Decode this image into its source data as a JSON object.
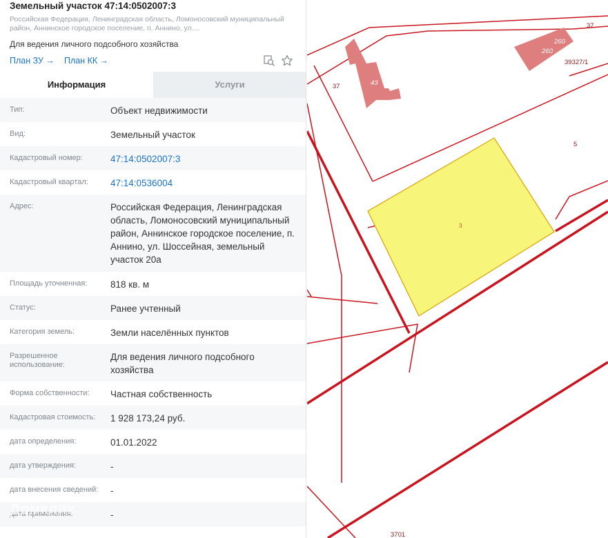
{
  "header": {
    "title": "Земельный участок 47:14:0502007:3",
    "address_short": "Российская Федерация, Ленинградская область, Ломоносовский муниципальный район, Аннинское городское поселение, п. Аннино, ул....",
    "purpose": "Для ведения личного подсобного хозяйства",
    "plan_zu": "План ЗУ →",
    "plan_kk": "План КК →"
  },
  "tabs": [
    {
      "label": "Информация"
    },
    {
      "label": "Услуги"
    }
  ],
  "info": [
    {
      "label": "Тип:",
      "value": "Объект недвижимости"
    },
    {
      "label": "Вид:",
      "value": "Земельный участок"
    },
    {
      "label": "Кадастровый номер:",
      "value": "47:14:0502007:3"
    },
    {
      "label": "Кадастровый квартал:",
      "value": "47:14:0536004"
    },
    {
      "label": "Адрес:",
      "value": "Российская Федерация, Ленинградская область, Ломоносовский муниципальный район, Аннинское городское поселение, п. Аннино, ул. Шоссейная, земельный участок 20а"
    },
    {
      "label": "Площадь уточненная:",
      "value": "818 кв. м"
    },
    {
      "label": "Статус:",
      "value": "Ранее учтенный"
    },
    {
      "label": "Категория земель:",
      "value": "Земли населённых пунктов"
    },
    {
      "label": "Разрешенное использование:",
      "value": "Для ведения личного подсобного хозяйства"
    },
    {
      "label": "Форма собственности:",
      "value": "Частная собственность"
    },
    {
      "label": "Кадастровая стоимость:",
      "value": "1 928 173,24 руб."
    },
    {
      "label": "дата определения:",
      "value": "01.01.2022"
    },
    {
      "label": "дата утверждения:",
      "value": "-"
    },
    {
      "label": "дата внесения сведений:",
      "value": "-"
    },
    {
      "label": "дата применения:",
      "value": "-"
    }
  ],
  "map": {
    "labels": {
      "a": "37",
      "b": "37",
      "c": "43",
      "d": "260",
      "e": "260",
      "f": "39327/1",
      "g": "5",
      "h": "3",
      "i": "3701"
    },
    "watermark": "Домклик",
    "colors": {
      "boundary": "#c8141e",
      "parcel": "#f7f57a",
      "building": "#df7e7e"
    }
  }
}
